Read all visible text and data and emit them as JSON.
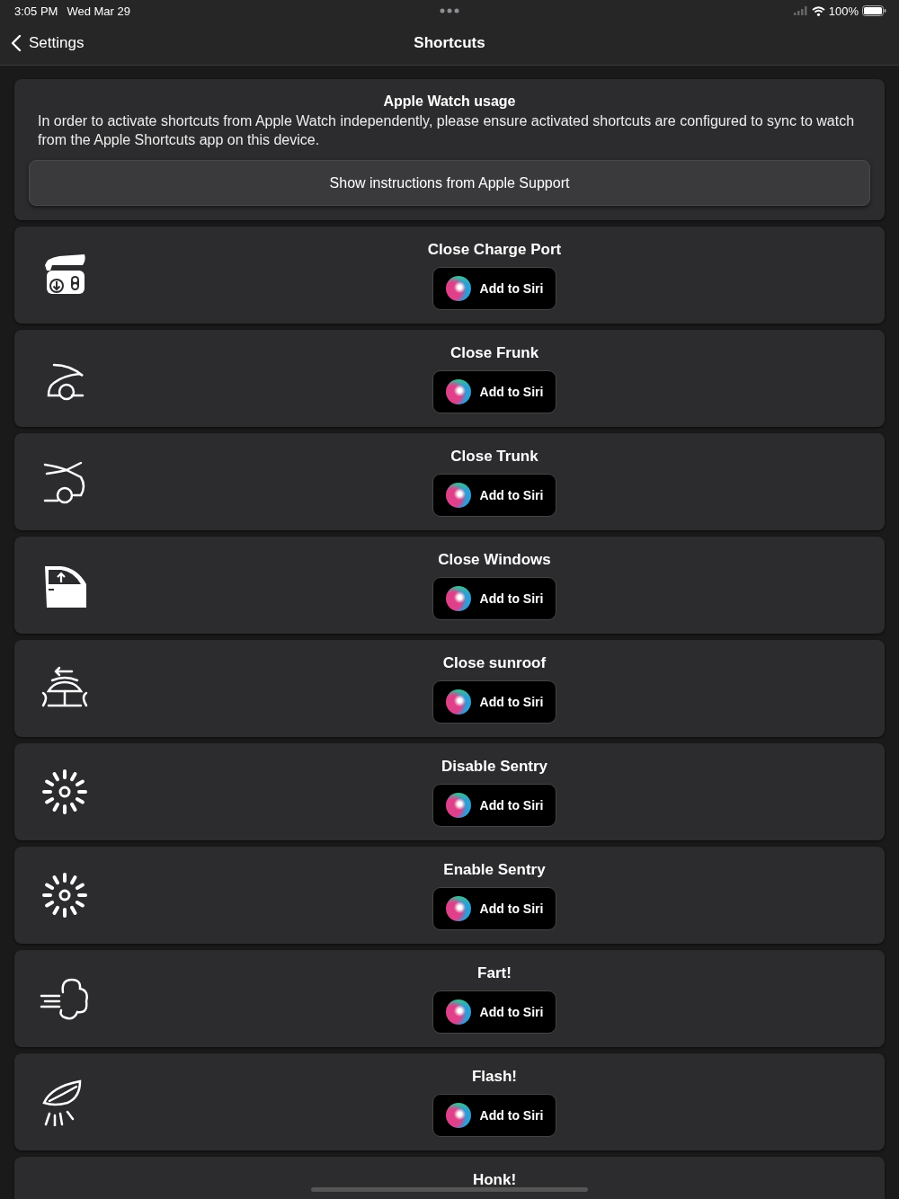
{
  "status_bar": {
    "time": "3:05 PM",
    "date": "Wed Mar 29",
    "battery": "100%"
  },
  "nav": {
    "back": "Settings",
    "title": "Shortcuts"
  },
  "info": {
    "title": "Apple Watch usage",
    "text": "In order to activate shortcuts from Apple Watch independently, please ensure activated shortcuts are configured to sync to watch from the Apple Shortcuts app on this device.",
    "button": "Show instructions from Apple Support"
  },
  "shortcuts": [
    {
      "kind": "charge-port",
      "title": "Close Charge Port",
      "button": "Add to Siri"
    },
    {
      "kind": "frunk",
      "title": "Close Frunk",
      "button": "Add to Siri"
    },
    {
      "kind": "trunk",
      "title": "Close Trunk",
      "button": "Add to Siri"
    },
    {
      "kind": "window",
      "title": "Close Windows",
      "button": "Add to Siri"
    },
    {
      "kind": "sunroof",
      "title": "Close sunroof",
      "button": "Add to Siri"
    },
    {
      "kind": "sentry",
      "title": "Disable Sentry",
      "button": "Add to Siri"
    },
    {
      "kind": "sentry",
      "title": "Enable Sentry",
      "button": "Add to Siri"
    },
    {
      "kind": "fart",
      "title": "Fart!",
      "button": "Add to Siri"
    },
    {
      "kind": "flash",
      "title": "Flash!",
      "button": "Add to Siri"
    },
    {
      "title": "Honk!"
    }
  ]
}
